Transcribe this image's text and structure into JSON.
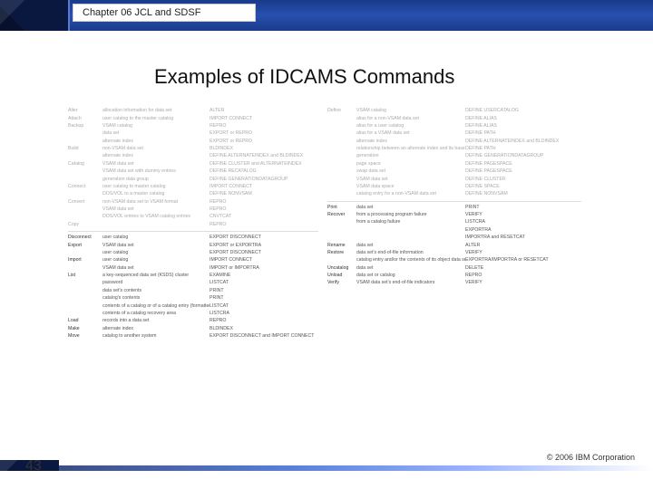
{
  "chapter": "Chapter 06 JCL and SDSF",
  "title": "Examples of IDCAMS Commands",
  "page_number": "43",
  "copyright": "© 2006 IBM Corporation",
  "left_upper": [
    [
      "Alter",
      "allocation information for data set",
      "ALTER"
    ],
    [
      "Attach",
      "user catalog to the master catalog",
      "IMPORT CONNECT"
    ],
    [
      "Backup",
      "VSAM catalog",
      "REPRO"
    ],
    [
      "",
      "data set",
      "EXPORT or REPRO"
    ],
    [
      "",
      "alternate index",
      "EXPORT or REPRO"
    ],
    [
      "Build",
      "non-VSAM data set",
      "BLDINDEX"
    ],
    [
      "",
      "alternate index",
      "DEFINE ALTERNATEINDEX and BLDINDEX"
    ],
    [
      "Catalog",
      "VSAM data set",
      "DEFINE CLUSTER and ALTERNATEINDEX"
    ],
    [
      "",
      "VSAM data set with dummy entries",
      "DEFINE RECATALOG"
    ],
    [
      "",
      "generation data group",
      "DEFINE GENERATIONDATAGROUP"
    ],
    [
      "Connect",
      "user catalog to master catalog",
      "IMPORT CONNECT"
    ],
    [
      "",
      "DOS/VOL to a master catalog",
      "DEFINE NONVSAM"
    ],
    [
      "Convert",
      "non-VSAM data set to VSAM format",
      "REPRO"
    ],
    [
      "",
      "VSAM data set",
      "REPRO"
    ],
    [
      "",
      "DOS/VOL entries to VSAM catalog entries",
      "CNVTCAT"
    ],
    [
      "Copy",
      "",
      "REPRO"
    ]
  ],
  "left_lower": [
    [
      "Disconnect",
      "user catalog",
      "EXPORT DISCONNECT"
    ],
    [
      "Export",
      "VSAM data set",
      "EXPORT or EXPORTRA"
    ],
    [
      "",
      "user catalog",
      "EXPORT DISCONNECT"
    ],
    [
      "Import",
      "user catalog",
      "IMPORT CONNECT"
    ],
    [
      "",
      "VSAM data set",
      "IMPORT or IMPORTRA"
    ],
    [
      "List",
      "a key-sequenced data set (KSDS) cluster",
      "EXAMINE"
    ],
    [
      "",
      "password",
      "LISTCAT"
    ],
    [
      "",
      "data set's contents",
      "PRINT"
    ],
    [
      "",
      "catalog's contents",
      "PRINT"
    ],
    [
      "",
      "contents of a catalog or of a catalog entry (formatted)",
      "LISTCAT"
    ],
    [
      "",
      "contents of a catalog recovery area",
      "LISTCRA"
    ],
    [
      "Load",
      "records into a data set",
      "REPRO"
    ],
    [
      "Make",
      "alternate index",
      "BLDINDEX"
    ],
    [
      "Move",
      "catalog to another system",
      "EXPORT DISCONNECT and IMPORT CONNECT"
    ]
  ],
  "right_upper": [
    [
      "Define",
      "VSAM catalog",
      "DEFINE USERCATALOG"
    ],
    [
      "",
      "alias for a non-VSAM data set",
      "DEFINE ALIAS"
    ],
    [
      "",
      "alias for a user catalog",
      "DEFINE ALIAS"
    ],
    [
      "",
      "alias for a VSAM data set",
      "DEFINE PATH"
    ],
    [
      "",
      "alternate index",
      "DEFINE ALTERNATEINDEX and BLDINDEX"
    ],
    [
      "",
      "relationship between an alternate index and its base cluster (data set path)",
      "DEFINE PATH"
    ],
    [
      "",
      "generation",
      "DEFINE GENERATIONDATAGROUP"
    ],
    [
      "",
      "page space",
      "DEFINE PAGESPACE"
    ],
    [
      "",
      "swap data set",
      "DEFINE PAGESPACE"
    ],
    [
      "",
      "VSAM data set",
      "DEFINE CLUSTER"
    ],
    [
      "",
      "VSAM data space",
      "DEFINE SPACE"
    ],
    [
      "",
      "catalog entry for a non-VSAM data set",
      "DEFINE NONVSAM"
    ]
  ],
  "right_lower": [
    [
      "Print",
      "data set",
      "PRINT"
    ],
    [
      "Recover",
      "from a processing program failure",
      "VERIFY"
    ],
    [
      "",
      "from a catalog failure",
      "LISTCRA"
    ],
    [
      "",
      "",
      "EXPORTRA"
    ],
    [
      "",
      "",
      "IMPORTRA and RESETCAT"
    ],
    [
      "Rename",
      "data set",
      "ALTER"
    ],
    [
      "Restore",
      "data set's end-of-file information",
      "VERIFY"
    ],
    [
      "",
      "catalog entry and/or the contents of its object data set from a portable copy",
      "EXPORTRA/IMPORTRA or RESETCAT"
    ],
    [
      "Uncatalog",
      "data set",
      "DELETE"
    ],
    [
      "Unload",
      "data set or catalog",
      "REPRO"
    ],
    [
      "Verify",
      "VSAM data set's end-of-file indicators",
      "VERIFY"
    ]
  ]
}
